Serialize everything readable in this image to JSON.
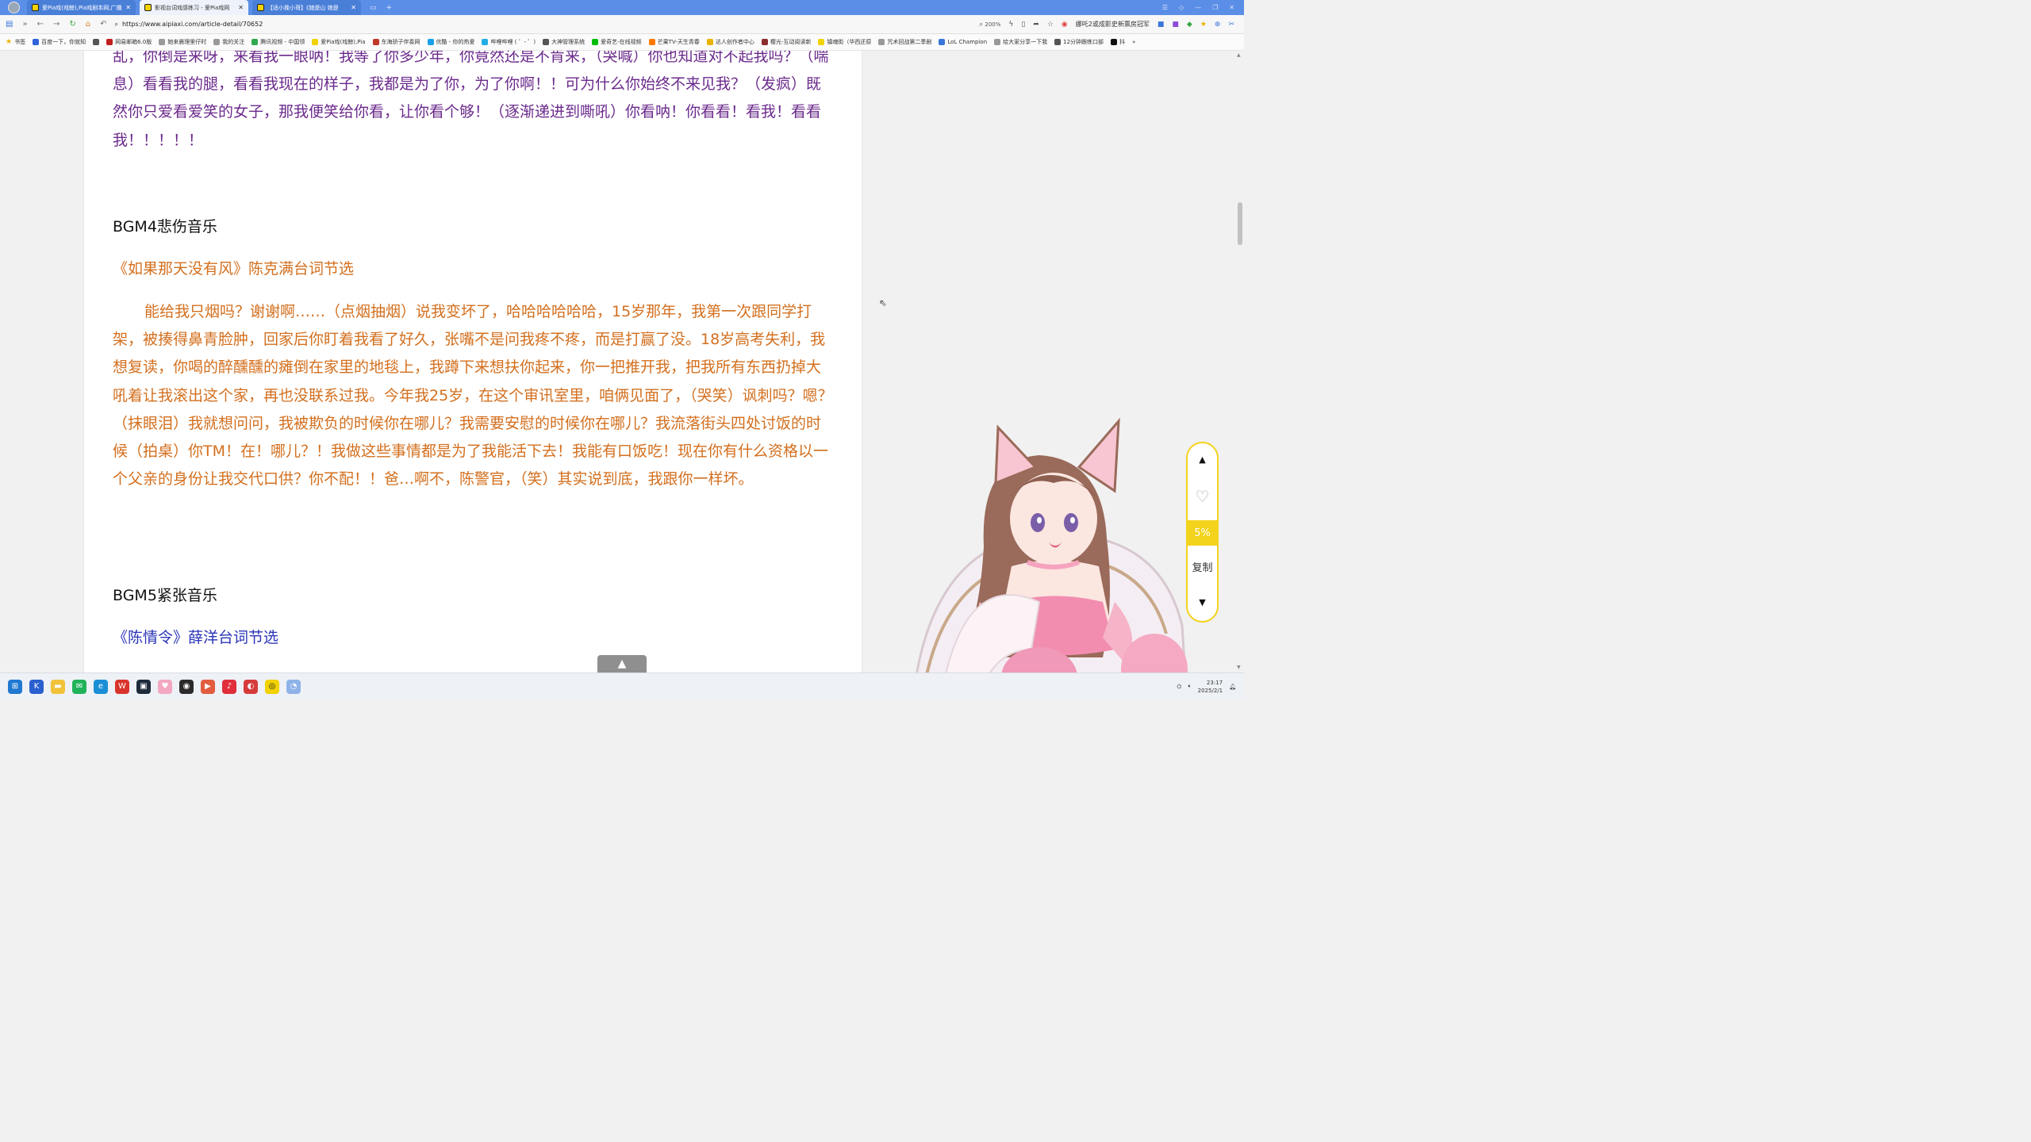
{
  "browser": {
    "tabs": [
      {
        "title": "爱Pia戏(戏鲸),Pia戏剧本网,广播剧",
        "active": false
      },
      {
        "title": "影视台词戏感练习 - 爱Pia戏网",
        "active": true
      },
      {
        "title": "【适小挽小哥】《她是山 她是",
        "active": false
      }
    ],
    "new_tab_symbol": "+",
    "address": {
      "url": "https://www.aipiaxi.com/article-detail/70652",
      "zoom": "200%",
      "news_text": "娜吒2或成影史新票房冠军"
    },
    "bookmarks": [
      "书签",
      "百度一下，你就知",
      "网易邮箱6.0版",
      "她来晨理里仔时",
      "我的关注",
      "腾讯视频 - 中国领",
      "爱Pia戏(戏鲸),Pia",
      "东海骄子伴奏网",
      "优酷 - 你的热爱",
      "哔哩哔哩 ( ゜- ゜)",
      "大神管理系统",
      "爱奇艺-在线视频",
      "芒果TV-天生青春",
      "达人创作者中心",
      "樱光-互动阅读新",
      "镇魂街（华西还原",
      "咒术回战第二季剧",
      "LoL Champion",
      "给大家分享一下我",
      "12分钟跟练口部",
      "抖"
    ]
  },
  "article": {
    "intro_paragraph": "乱，你倒是来呀，来看我一眼呐！我等了你多少年，你竟然还是不肯来，（哭喊）你也知道对不起我吗？（喘息）看看我的腿，看看我现在的样子，我都是为了你，为了你啊！！可为什么你始终不来见我？（发疯）既然你只爱看爱笑的女子，那我便笑给你看，让你看个够！（逐渐递进到嘶吼）你看呐！你看看！看我！看看我！！！！！",
    "section4": {
      "heading": "BGM4悲伤音乐",
      "subtitle": "《如果那天没有风》陈克满台词节选",
      "body": "能给我只烟吗？谢谢啊……（点烟抽烟）说我变坏了，哈哈哈哈哈哈，15岁那年，我第一次跟同学打架，被揍得鼻青脸肿，回家后你盯着我看了好久，张嘴不是问我疼不疼，而是打赢了没。18岁高考失利，我想复读，你喝的醉醺醺的瘫倒在家里的地毯上，我蹲下来想扶你起来，你一把推开我，把我所有东西扔掉大吼着让我滚出这个家，再也没联系过我。今年我25岁，在这个审讯室里，咱俩见面了，（哭笑）讽刺吗？嗯？（抹眼泪）我就想问问，我被欺负的时候你在哪儿？我需要安慰的时候你在哪儿？我流落街头四处讨饭的时候（拍桌）你TM！在！哪儿？！我做这些事情都是为了我能活下去！我能有口饭吃！现在你有什么资格以一个父亲的身份让我交代口供？你不配！！爸…啊不，陈警官，（笑）其实说到底，我跟你一样坏。"
    },
    "section5": {
      "heading": "BGM5紧张音乐",
      "subtitle": "《陈情令》薛洋台词节选"
    }
  },
  "float_panel": {
    "percent": "5%",
    "copy_label": "复制"
  },
  "taskbar": {
    "time": "23:17",
    "date": "2025/2/1"
  },
  "colors": {
    "tab_bar": "#5b8ee6",
    "purple_text": "#6b2a8c",
    "orange_text": "#d36f1e",
    "blue_text": "#2a34b8",
    "panel_yellow": "#f3d31b"
  }
}
